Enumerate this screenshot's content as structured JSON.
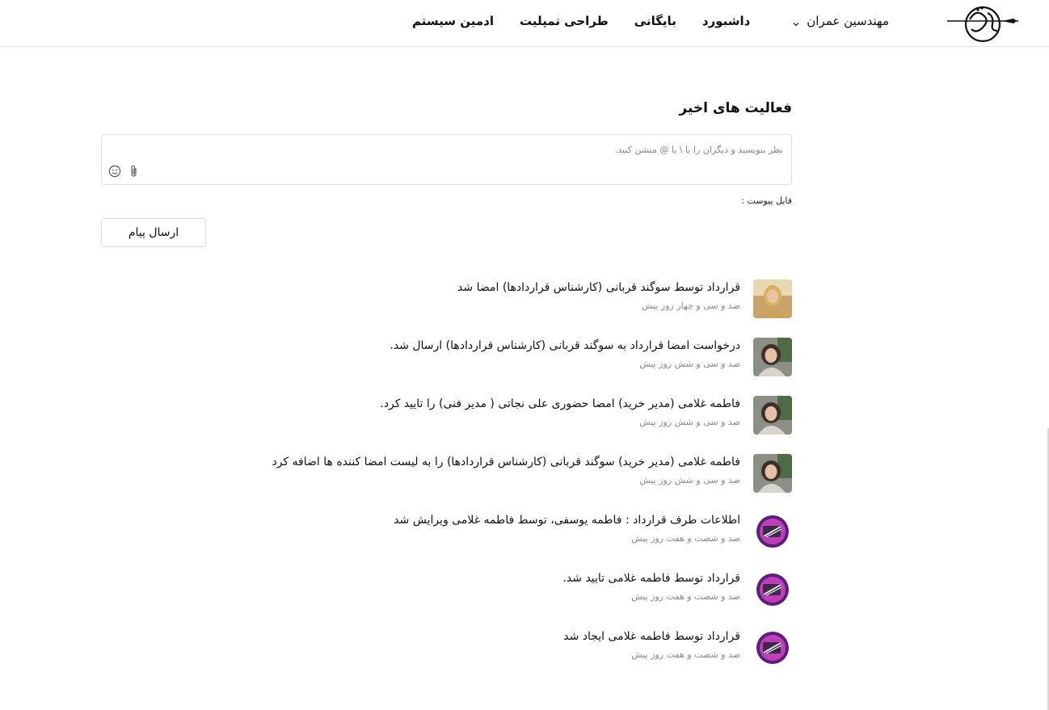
{
  "header": {
    "user_menu": "مهندسین عمران",
    "nav": {
      "dashboard": "داشبورد",
      "archive": "بایگانی",
      "template_design": "طراحی تمپلیت",
      "system_admin": "ادمین سیستم"
    }
  },
  "activity": {
    "title": "فعالیت های اخیر",
    "comment_placeholder": "نظر بنویسید و دیگران را با \\ یا @ منشن کنید.",
    "attachment_label": "فایل پیوست :",
    "send_label": "ارسال پیام",
    "items": [
      {
        "text": "قرارداد توسط سوگند قربانی (کارشناس قراردادها) امضا شد",
        "time": "صد و سی و چهار روز پیش",
        "avatar": "photo-woman-1"
      },
      {
        "text": "درخواست امضا قرارداد به سوگند قربانی (کارشناس قراردادها) ارسال شد.",
        "time": "صد و سی و شش روز پیش",
        "avatar": "photo-woman-2"
      },
      {
        "text": "فاطمه غلامی (مدیر خرید) امضا حضوری علی نجاتی ( مدیر فنی) را تایید کرد.",
        "time": "صد و سی و شش روز پیش",
        "avatar": "photo-woman-2"
      },
      {
        "text": "فاطمه غلامی (مدیر خرید) سوگند قربانی (کارشناس قراردادها) را به لیست امضا کننده ها اضافه کرد",
        "time": "صد و سی و شش روز پیش",
        "avatar": "photo-woman-2"
      },
      {
        "text": "اطلاعات طرف قرارداد : فاطمه یوسفی، توسط فاطمه غلامی ویرایش شد",
        "time": "صد و شصت و هفت روز پیش",
        "avatar": "system-icon"
      },
      {
        "text": "قرارداد توسط فاطمه غلامی تایید شد.",
        "time": "صد و شصت و هفت روز پیش",
        "avatar": "system-icon"
      },
      {
        "text": "قرارداد توسط فاطمه غلامی ایجاد شد",
        "time": "صد و شصت و هفت روز پیش",
        "avatar": "system-icon"
      }
    ]
  },
  "colors": {
    "accent_purple": "#7b2fa8",
    "border": "#e2e2e2",
    "muted_text": "#8a8a8a"
  }
}
